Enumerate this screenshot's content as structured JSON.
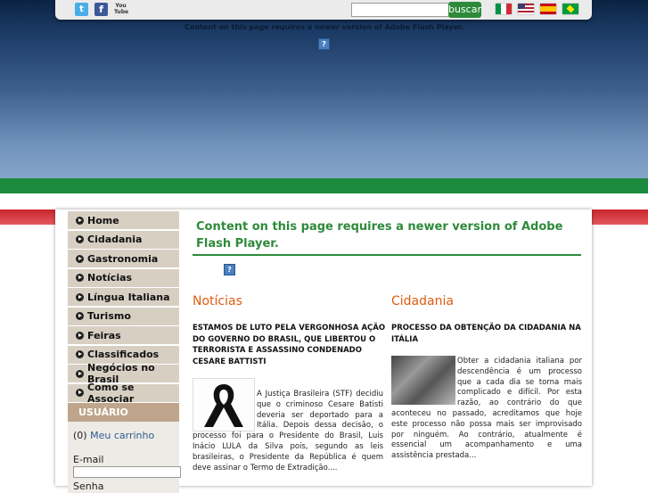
{
  "header": {
    "social": {
      "facebook_glyph": "f",
      "youtube_glyph": "You Tube",
      "twitter_glyph": "t"
    },
    "search": {
      "button_label": "buscar",
      "placeholder": ""
    },
    "flags": [
      "italy-flag",
      "usa-flag",
      "spain-flag",
      "brazil-flag"
    ],
    "flash_notice": "Content on this page requires a newer version of Adobe Flash Player.",
    "plugin_glyph": "?"
  },
  "sidebar": {
    "menu": [
      {
        "label": "Home"
      },
      {
        "label": "Cidadania"
      },
      {
        "label": "Gastronomia"
      },
      {
        "label": "Notícias"
      },
      {
        "label": "Língua Italiana"
      },
      {
        "label": "Turismo"
      },
      {
        "label": "Feiras"
      },
      {
        "label": "Classificados"
      },
      {
        "label": "Negócios no Brasil"
      },
      {
        "label": "Como se Associar"
      }
    ],
    "user": {
      "header": "USUÁRIO",
      "cart_count": "(0)",
      "cart_label": "Meu carrinho",
      "email_label": "E-mail",
      "password_label": "Senha"
    }
  },
  "main": {
    "flash_notice": "Content on this page requires a newer version of Adobe Flash Player.",
    "news": {
      "title": "Notícias",
      "headline": "ESTAMOS DE LUTO PELA VERGONHOSA AÇÃO DO GOVERNO DO BRASIL, QUE LIBERTOU O TERRORISTA E ASSASSINO CONDENADO CESARE BATTISTI",
      "body": "A Justiça Brasileira (STF) decidiu que o criminoso Cesare Batisti deveria ser deportado para a Itália.  Depois dessa decisão, o processo foi para o Presidente do Brasil, Luis Inácio LULA da Silva pois, segundo as leis brasileiras, o Presidente da República é quem deve assinar o Termo de Extradição...."
    },
    "citizenship": {
      "title": "Cidadania",
      "headline": "PROCESSO DA OBTENÇÃO DA CIDADANIA NA ITÁLIA",
      "body": "Obter a cidadania italiana por descendência é um processo que a cada dia se torna mais complicado e difícil. Por esta razão, ao contrário do que aconteceu no passado, acreditamos que hoje este processo não possa mais ser improvisado por ninguém. Ao contrário, atualmente é essencial um acompanhamento e uma assistência prestada..."
    }
  },
  "colors": {
    "green": "#1c8a3c",
    "red": "#c9252d",
    "accent_orange": "#e05c10",
    "menu_bg": "#d8cfc3",
    "user_header_bg": "#bfa58b"
  }
}
